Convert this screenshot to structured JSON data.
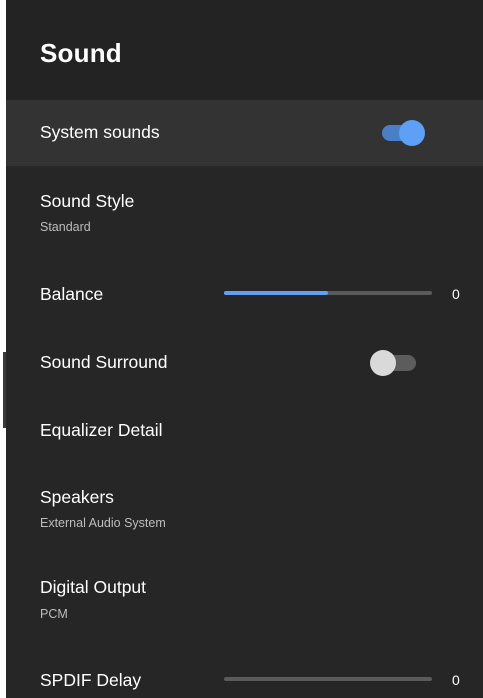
{
  "header": {
    "title": "Sound"
  },
  "items": {
    "system_sounds": {
      "label": "System sounds",
      "on": true
    },
    "sound_style": {
      "label": "Sound Style",
      "value": "Standard"
    },
    "balance": {
      "label": "Balance",
      "value": "0",
      "level": 0.5
    },
    "sound_surround": {
      "label": "Sound Surround",
      "on": false
    },
    "equalizer_detail": {
      "label": "Equalizer Detail"
    },
    "speakers": {
      "label": "Speakers",
      "value": "External Audio System"
    },
    "digital_output": {
      "label": "Digital Output",
      "value": "PCM"
    },
    "spdif_delay": {
      "label": "SPDIF Delay",
      "value": "0",
      "level": 0
    }
  },
  "colors": {
    "accent": "#5ea0f5",
    "background": "#232323",
    "highlight_row": "#333333",
    "toggle_off_thumb": "#d9d9d9",
    "toggle_off_track": "#5c5c5c"
  }
}
